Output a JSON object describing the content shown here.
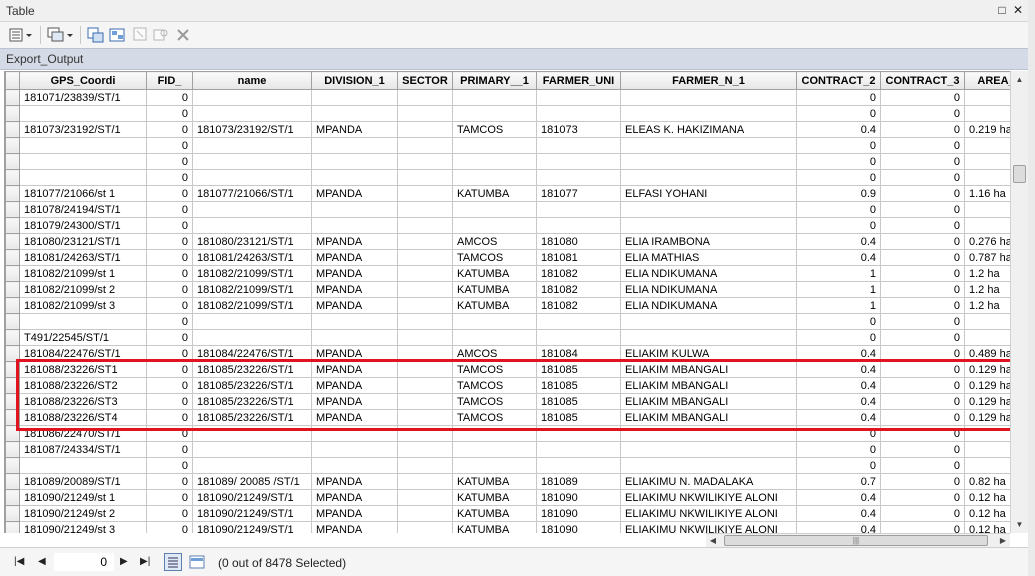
{
  "window": {
    "title": "Table"
  },
  "tab": {
    "label": "Export_Output"
  },
  "columns": [
    "GPS_Coordi",
    "FID_",
    "name",
    "DIVISION_1",
    "SECTOR",
    "PRIMARY__1",
    "FARMER_UNI",
    "FARMER_N_1",
    "CONTRACT_2",
    "CONTRACT_3",
    "AREA_H"
  ],
  "rows": [
    [
      "181071/23839/ST/1",
      "0",
      "",
      "",
      "",
      "",
      "",
      "",
      "0",
      "0",
      ""
    ],
    [
      "",
      "0",
      "",
      "",
      "",
      "",
      "",
      "",
      "0",
      "0",
      ""
    ],
    [
      "181073/23192/ST/1",
      "0",
      "181073/23192/ST/1",
      "MPANDA",
      "",
      "TAMCOS",
      "181073",
      "ELEAS K. HAKIZIMANA",
      "0.4",
      "0",
      "0.219 ha"
    ],
    [
      "",
      "0",
      "",
      "",
      "",
      "",
      "",
      "",
      "0",
      "0",
      ""
    ],
    [
      "",
      "0",
      "",
      "",
      "",
      "",
      "",
      "",
      "0",
      "0",
      ""
    ],
    [
      "",
      "0",
      "",
      "",
      "",
      "",
      "",
      "",
      "0",
      "0",
      ""
    ],
    [
      "181077/21066/st 1",
      "0",
      "181077/21066/ST/1",
      "MPANDA",
      "",
      "KATUMBA",
      "181077",
      "ELFASI YOHANI",
      "0.9",
      "0",
      "1.16 ha"
    ],
    [
      "181078/24194/ST/1",
      "0",
      "",
      "",
      "",
      "",
      "",
      "",
      "0",
      "0",
      ""
    ],
    [
      "181079/24300/ST/1",
      "0",
      "",
      "",
      "",
      "",
      "",
      "",
      "0",
      "0",
      ""
    ],
    [
      "181080/23121/ST/1",
      "0",
      "181080/23121/ST/1",
      "MPANDA",
      "",
      "AMCOS",
      "181080",
      "ELIA IRAMBONA",
      "0.4",
      "0",
      "0.276 ha"
    ],
    [
      "181081/24263/ST/1",
      "0",
      "181081/24263/ST/1",
      "MPANDA",
      "",
      "TAMCOS",
      "181081",
      "ELIA MATHIAS",
      "0.4",
      "0",
      "0.787 ha"
    ],
    [
      "181082/21099/st 1",
      "0",
      "181082/21099/ST/1",
      "MPANDA",
      "",
      "KATUMBA",
      "181082",
      "ELIA NDIKUMANA",
      "1",
      "0",
      "1.2 ha"
    ],
    [
      "181082/21099/st 2",
      "0",
      "181082/21099/ST/1",
      "MPANDA",
      "",
      "KATUMBA",
      "181082",
      "ELIA NDIKUMANA",
      "1",
      "0",
      "1.2 ha"
    ],
    [
      "181082/21099/st 3",
      "0",
      "181082/21099/ST/1",
      "MPANDA",
      "",
      "KATUMBA",
      "181082",
      "ELIA NDIKUMANA",
      "1",
      "0",
      "1.2 ha"
    ],
    [
      "",
      "0",
      "",
      "",
      "",
      "",
      "",
      "",
      "0",
      "0",
      ""
    ],
    [
      "T491/22545/ST/1",
      "0",
      "",
      "",
      "",
      "",
      "",
      "",
      "0",
      "0",
      ""
    ],
    [
      "181084/22476/ST/1",
      "0",
      "181084/22476/ST/1",
      "MPANDA",
      "",
      "AMCOS",
      "181084",
      "ELIAKIM KULWA",
      "0.4",
      "0",
      "0.489 ha"
    ],
    [
      "181088/23226/ST1",
      "0",
      "181085/23226/ST/1",
      "MPANDA",
      "",
      "TAMCOS",
      "181085",
      "ELIAKIM MBANGALI",
      "0.4",
      "0",
      "0.129 ha"
    ],
    [
      "181088/23226/ST2",
      "0",
      "181085/23226/ST/1",
      "MPANDA",
      "",
      "TAMCOS",
      "181085",
      "ELIAKIM MBANGALI",
      "0.4",
      "0",
      "0.129 ha"
    ],
    [
      "181088/23226/ST3",
      "0",
      "181085/23226/ST/1",
      "MPANDA",
      "",
      "TAMCOS",
      "181085",
      "ELIAKIM MBANGALI",
      "0.4",
      "0",
      "0.129 ha"
    ],
    [
      "181088/23226/ST4",
      "0",
      "181085/23226/ST/1",
      "MPANDA",
      "",
      "TAMCOS",
      "181085",
      "ELIAKIM MBANGALI",
      "0.4",
      "0",
      "0.129 ha"
    ],
    [
      "181086/22470/ST/1",
      "0",
      "",
      "",
      "",
      "",
      "",
      "",
      "0",
      "0",
      ""
    ],
    [
      "181087/24334/ST/1",
      "0",
      "",
      "",
      "",
      "",
      "",
      "",
      "0",
      "0",
      ""
    ],
    [
      "",
      "0",
      "",
      "",
      "",
      "",
      "",
      "",
      "0",
      "0",
      ""
    ],
    [
      "181089/20089/ST/1",
      "0",
      "181089/ 20085 /ST/1",
      "MPANDA",
      "",
      "KATUMBA",
      "181089",
      "ELIAKIMU N. MADALAKA",
      "0.7",
      "0",
      "0.82 ha"
    ],
    [
      "181090/21249/st 1",
      "0",
      "181090/21249/ST/1",
      "MPANDA",
      "",
      "KATUMBA",
      "181090",
      "ELIAKIMU NKWILIKIYE ALONI",
      "0.4",
      "0",
      "0.12 ha"
    ],
    [
      "181090/21249/st 2",
      "0",
      "181090/21249/ST/1",
      "MPANDA",
      "",
      "KATUMBA",
      "181090",
      "ELIAKIMU NKWILIKIYE ALONI",
      "0.4",
      "0",
      "0.12 ha"
    ],
    [
      "181090/21249/st 3",
      "0",
      "181090/21249/ST/1",
      "MPANDA",
      "",
      "KATUMBA",
      "181090",
      "ELIAKIMU NKWILIKIYE ALONI",
      "0.4",
      "0",
      "0.12 ha"
    ]
  ],
  "numeric_columns": [
    1,
    8,
    9
  ],
  "status": {
    "record_value": "0",
    "selection_text": "(0 out of 8478 Selected)"
  },
  "colors": {
    "highlight_border": "#e0141e"
  },
  "icons": [
    "table-options-icon",
    "related-tables-icon",
    "select-by-attributes-icon",
    "switch-selection-icon",
    "clear-selection-icon",
    "zoom-selected-icon",
    "delete-selected-icon",
    "restore-icon",
    "close-icon"
  ]
}
